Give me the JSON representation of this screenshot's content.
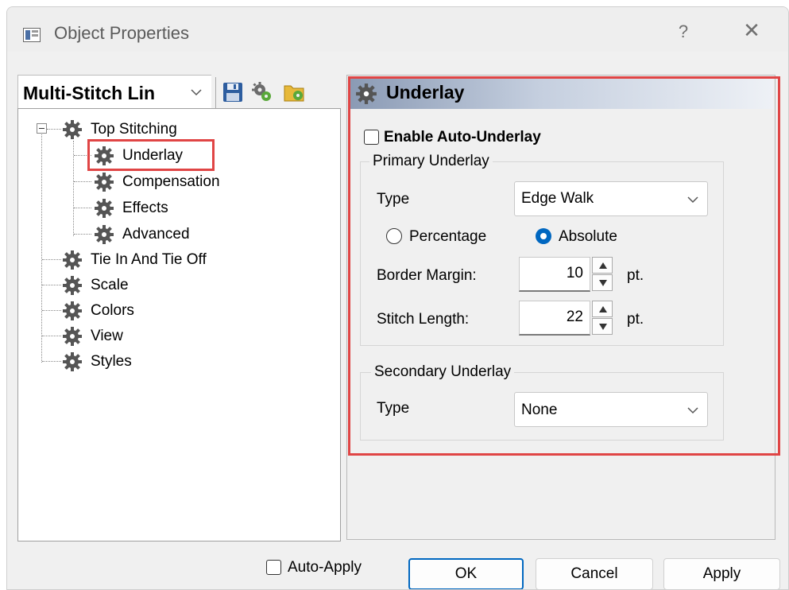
{
  "window": {
    "title": "Object Properties",
    "help": "?",
    "close": "✕"
  },
  "toolbar": {
    "combo_value": "Multi-Stitch Lin",
    "icons": [
      "save-icon",
      "settings-gears-icon",
      "load-settings-icon"
    ]
  },
  "tree": {
    "items": [
      {
        "label": "Top Stitching",
        "level": 0,
        "expanded": true
      },
      {
        "label": "Underlay",
        "level": 1,
        "selected": true
      },
      {
        "label": "Compensation",
        "level": 1
      },
      {
        "label": "Effects",
        "level": 1
      },
      {
        "label": "Advanced",
        "level": 1
      },
      {
        "label": "Tie In And Tie Off",
        "level": 0
      },
      {
        "label": "Scale",
        "level": 0
      },
      {
        "label": "Colors",
        "level": 0
      },
      {
        "label": "View",
        "level": 0
      },
      {
        "label": "Styles",
        "level": 0
      }
    ]
  },
  "panel": {
    "title": "Underlay",
    "enable_auto_underlay": {
      "label": "Enable Auto-Underlay",
      "checked": false
    },
    "primary": {
      "legend": "Primary Underlay",
      "type_label": "Type",
      "type_value": "Edge Walk",
      "radio_percentage": "Percentage",
      "radio_absolute": "Absolute",
      "selected_mode": "Absolute",
      "border_margin_label": "Border Margin:",
      "border_margin_value": "10",
      "border_margin_unit": "pt.",
      "stitch_length_label": "Stitch Length:",
      "stitch_length_value": "22",
      "stitch_length_unit": "pt."
    },
    "secondary": {
      "legend": "Secondary Underlay",
      "type_label": "Type",
      "type_value": "None"
    }
  },
  "footer": {
    "auto_apply": {
      "label": "Auto-Apply",
      "checked": false
    },
    "ok": "OK",
    "cancel": "Cancel",
    "apply": "Apply"
  },
  "colors": {
    "accent": "#0067c0",
    "highlight_red": "#e04545",
    "window_bg": "#f0f0f0"
  }
}
